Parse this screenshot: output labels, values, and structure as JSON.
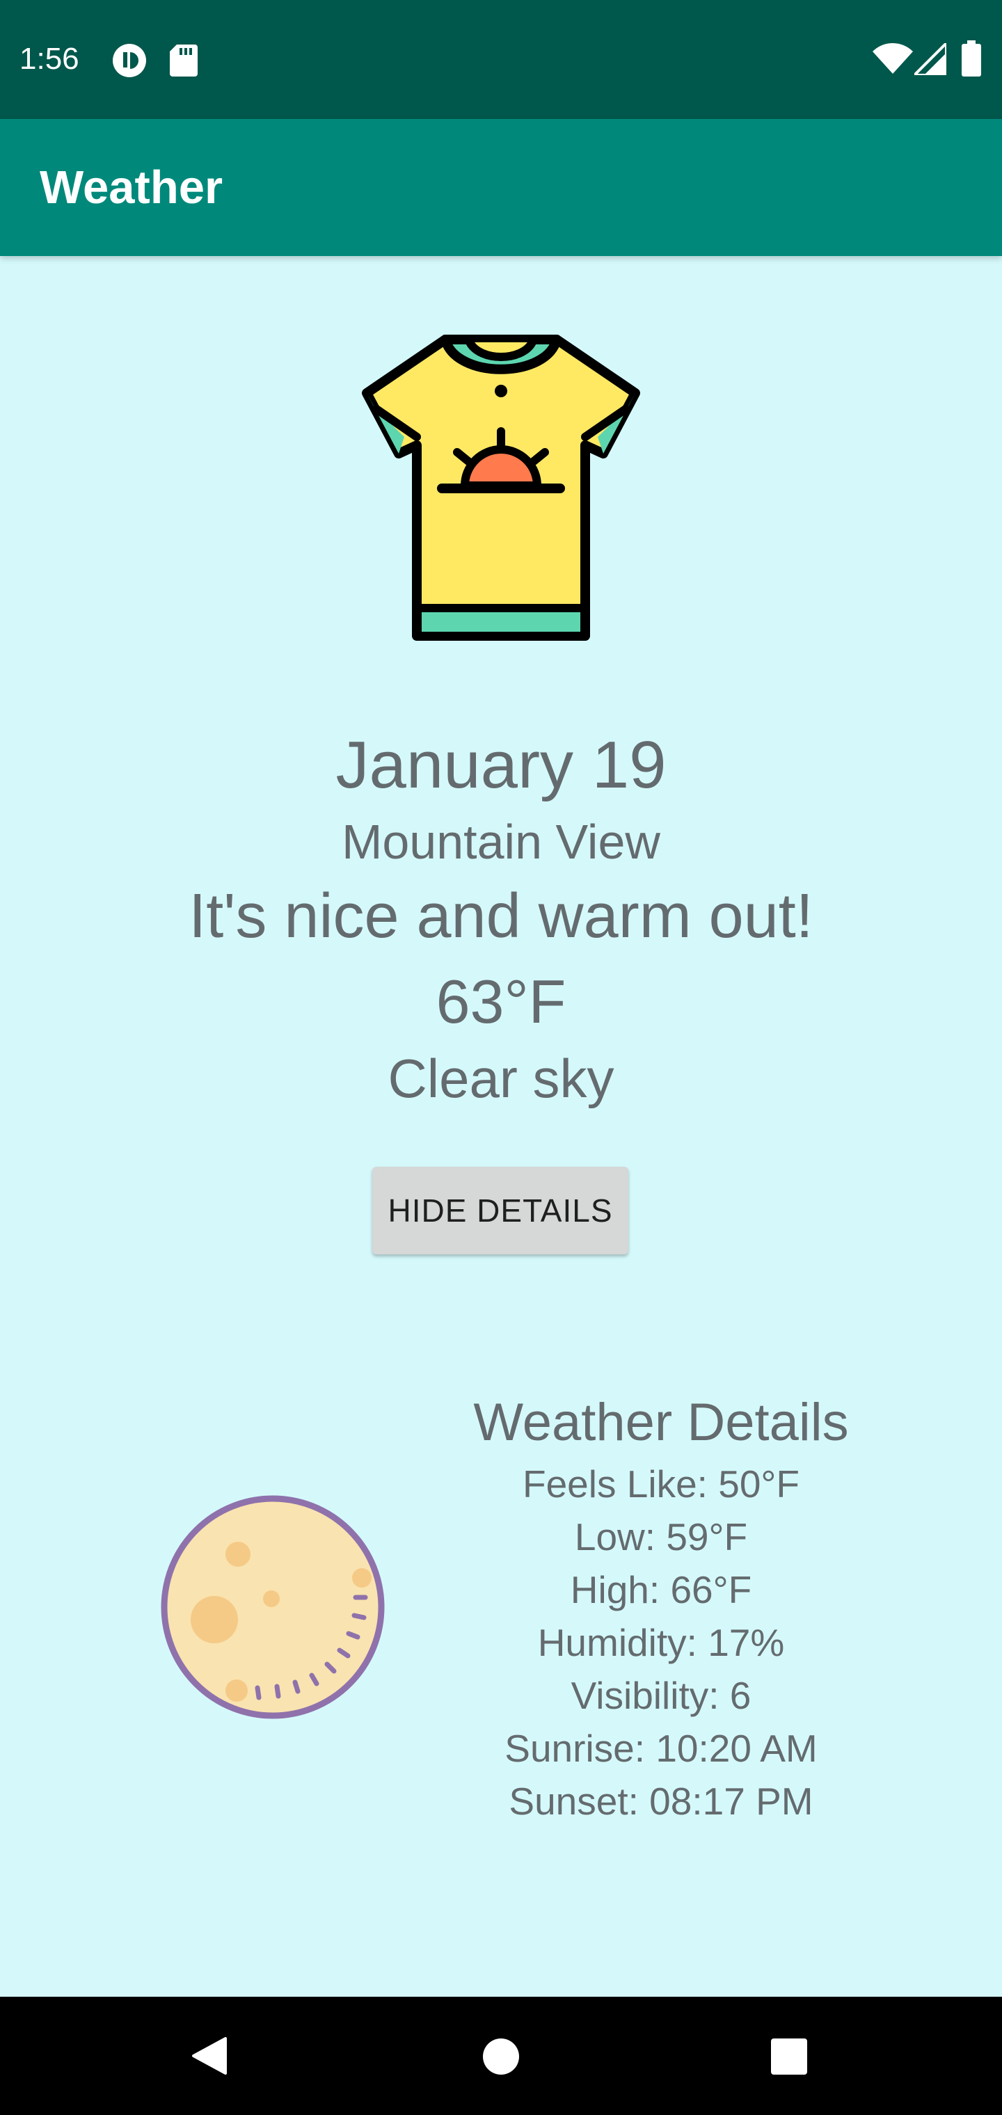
{
  "status_bar": {
    "time": "1:56",
    "left_icons": [
      "sync-icon",
      "sd-card-icon"
    ],
    "right_icons": [
      "wifi-icon",
      "signal-icon",
      "battery-icon"
    ]
  },
  "app_bar": {
    "title": "Weather"
  },
  "main": {
    "clothing_icon": "tshirt-icon",
    "date": "January 19",
    "city": "Mountain View",
    "message": "It's nice and warm out!",
    "temperature": "63°F",
    "description": "Clear sky",
    "hide_details_label": "HIDE DETAILS"
  },
  "details": {
    "weather_icon": "moon-icon",
    "title": "Weather Details",
    "feels_like": "Feels Like: 50°F",
    "low": "Low: 59°F",
    "high": "High: 66°F",
    "humidity": "Humidity: 17%",
    "visibility": "Visibility: 6",
    "sunrise": "Sunrise: 10:20 AM",
    "sunset": "Sunset: 08:17 PM"
  },
  "nav_bar": {
    "buttons": [
      "back-icon",
      "home-icon",
      "recents-icon"
    ]
  },
  "colors": {
    "status_bar": "#00574b",
    "app_bar": "#00897b",
    "background": "#d5f9fb",
    "text": "#646b6e",
    "button": "#d6d7d7"
  }
}
